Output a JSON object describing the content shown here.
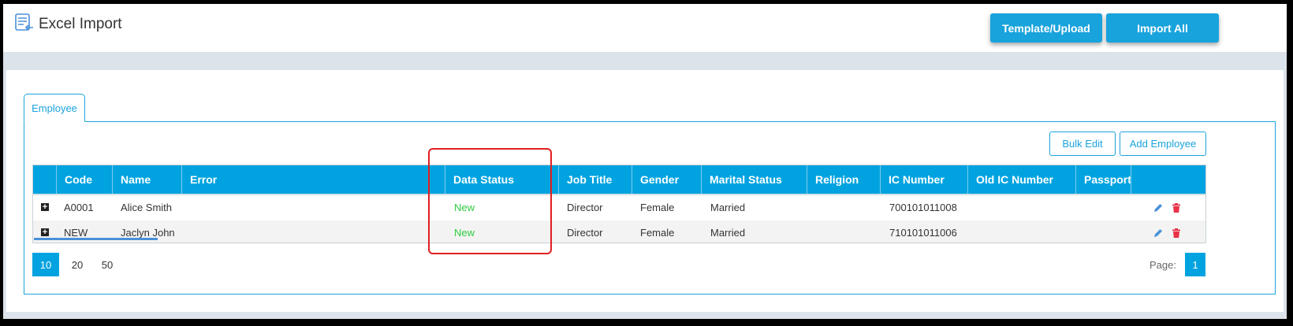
{
  "header": {
    "title": "Excel Import",
    "template_upload_label": "Template/Upload",
    "import_all_label": "Import All"
  },
  "tabs": [
    {
      "label": "Employee",
      "active": true
    }
  ],
  "toolbar": {
    "bulk_edit_label": "Bulk Edit",
    "add_employee_label": "Add Employee"
  },
  "grid": {
    "columns": [
      "Code",
      "Name",
      "Error",
      "Data Status",
      "Job Title",
      "Gender",
      "Marital Status",
      "Religion",
      "IC Number",
      "Old IC Number",
      "Passport"
    ],
    "rows": [
      {
        "code": "A0001",
        "name": "Alice Smith",
        "error": "",
        "data_status": "New",
        "job_title": "Director",
        "gender": "Female",
        "marital_status": "Married",
        "religion": "",
        "ic_number": "700101011008",
        "old_ic_number": "",
        "passport": ""
      },
      {
        "code": "NEW",
        "name": "Jaclyn John",
        "error": "",
        "data_status": "New",
        "job_title": "Director",
        "gender": "Female",
        "marital_status": "Married",
        "religion": "",
        "ic_number": "710101011006",
        "old_ic_number": "",
        "passport": ""
      }
    ]
  },
  "pager": {
    "page_sizes": [
      "10",
      "20",
      "50"
    ],
    "selected_page_size": "10",
    "page_label": "Page:",
    "current_page": "1"
  },
  "colors": {
    "accent": "#00a3e0",
    "status_new": "#2ecc40",
    "delete": "#e8334a",
    "highlight": "#e02020"
  }
}
